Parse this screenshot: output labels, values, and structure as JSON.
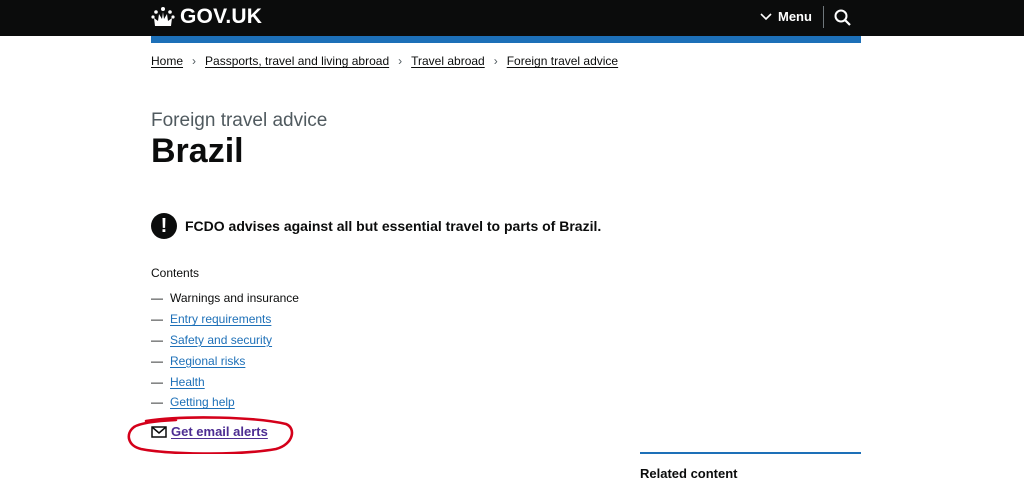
{
  "header": {
    "logo_text": "GOV.UK",
    "menu_label": "Menu",
    "search_icon": "search-icon"
  },
  "breadcrumbs": [
    {
      "label": "Home"
    },
    {
      "label": "Passports, travel and living abroad"
    },
    {
      "label": "Travel abroad"
    },
    {
      "label": "Foreign travel advice"
    }
  ],
  "page": {
    "caption": "Foreign travel advice",
    "title": "Brazil"
  },
  "warning": {
    "icon": "!",
    "text": "FCDO advises against all but essential travel to parts of Brazil."
  },
  "contents": {
    "title": "Contents",
    "items": [
      {
        "label": "Warnings and insurance",
        "current": true
      },
      {
        "label": "Entry requirements",
        "current": false
      },
      {
        "label": "Safety and security",
        "current": false
      },
      {
        "label": "Regional risks",
        "current": false
      },
      {
        "label": "Health",
        "current": false
      },
      {
        "label": "Getting help",
        "current": false
      }
    ]
  },
  "email_alerts": {
    "label": "Get email alerts"
  },
  "related": {
    "title": "Related content"
  },
  "colors": {
    "header_bg": "#0b0c0c",
    "brand_blue": "#1d70b8",
    "link_blue": "#1d70b8",
    "visited_purple": "#4c2c92",
    "annotation_red": "#d4001a"
  }
}
